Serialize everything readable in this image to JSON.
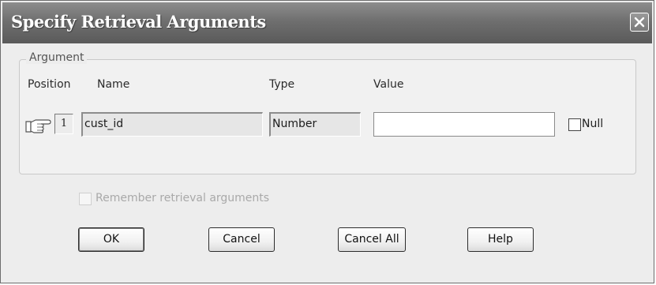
{
  "dialog": {
    "title": "Specify Retrieval Arguments",
    "close_icon": "close-icon"
  },
  "argument_group": {
    "legend": "Argument",
    "columns": {
      "position": "Position",
      "name": "Name",
      "type": "Type",
      "value": "Value"
    },
    "row": {
      "pointer_icon": "pointing-hand-icon",
      "position": "1",
      "name": "cust_id",
      "type": "Number",
      "value": "",
      "null_checked": false,
      "null_label": "Null"
    }
  },
  "remember": {
    "label": "Remember retrieval arguments",
    "checked": false,
    "enabled": false
  },
  "buttons": {
    "ok": "OK",
    "cancel": "Cancel",
    "cancel_all": "Cancel All",
    "help": "Help"
  }
}
